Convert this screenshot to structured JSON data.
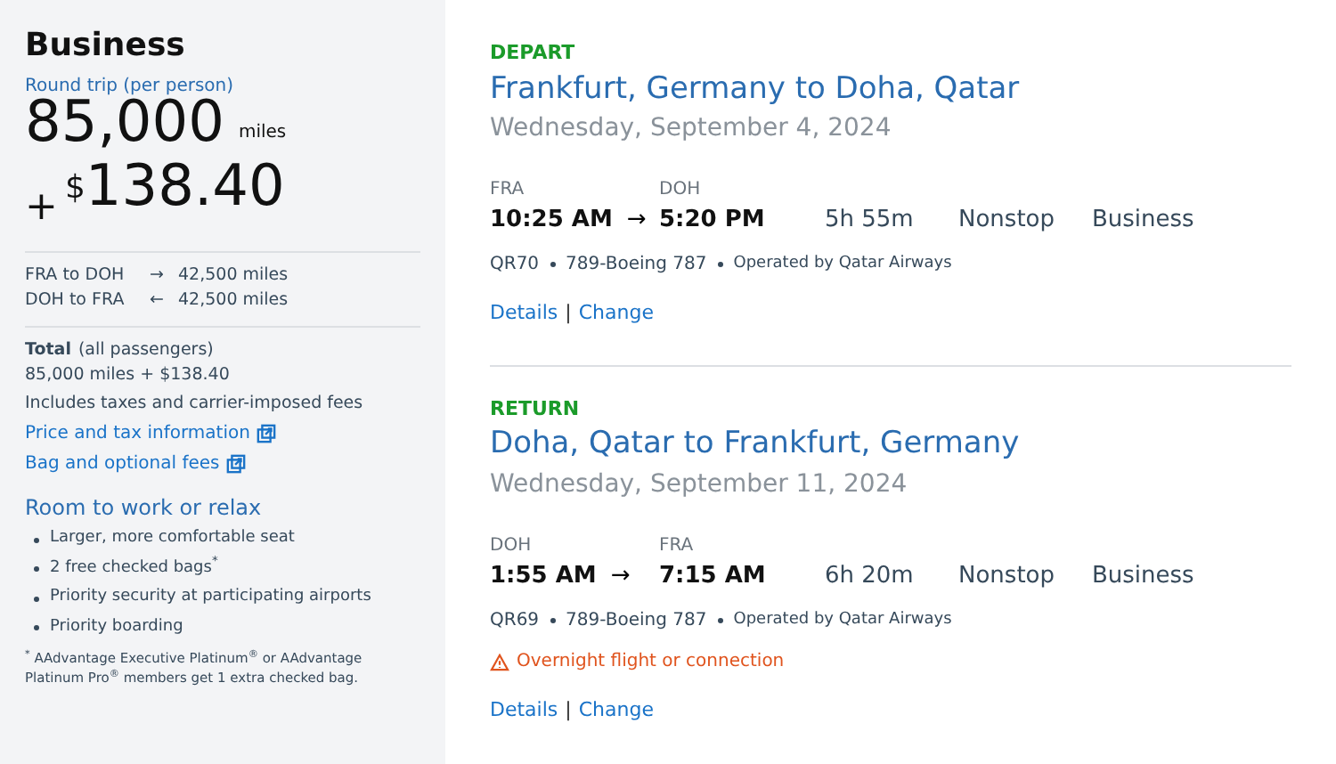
{
  "summary": {
    "cabin": "Business",
    "trip_type": "Round trip (per person)",
    "miles": "85,000",
    "miles_unit": "miles",
    "plus": "+",
    "currency": "$",
    "amount": "138.40",
    "segments": [
      {
        "route": "FRA to DOH",
        "arrow": "→",
        "miles": "42,500 miles"
      },
      {
        "route": "DOH to FRA",
        "arrow": "←",
        "miles": "42,500 miles"
      }
    ],
    "total_label": "Total",
    "total_note": "(all passengers)",
    "total_value": "85,000 miles + $138.40",
    "includes": "Includes taxes and carrier-imposed fees",
    "links": [
      "Price and tax information",
      "Bag and optional fees"
    ],
    "perks_title": "Room to work or relax",
    "perks": [
      "Larger, more comfortable seat",
      "2 free checked bags$^{*}$",
      "Priority security at participating airports",
      "Priority boarding"
    ],
    "footnote": "$^{*}$ AAdvantage Executive Platinum$^{®}$ or AAdvantage Platinum Pro$^{®}$ members get 1 extra checked bag."
  },
  "legs": [
    {
      "label": "DEPART",
      "title": "Frankfurt, Germany to Doha, Qatar",
      "date": "Wednesday, September 4, 2024",
      "from": "FRA",
      "to": "DOH",
      "depart_time": "10:25 AM",
      "arrow": "→",
      "arrive_time": "5:20 PM",
      "duration": "5h 55m",
      "stops": "Nonstop",
      "cabin": "Business",
      "flight": "QR70",
      "aircraft": "789-Boeing 787",
      "operator": "Operated by Qatar Airways",
      "links": [
        "Details",
        "Change"
      ],
      "link_separator": "|"
    },
    {
      "label": "RETURN",
      "title": "Doha, Qatar to Frankfurt, Germany",
      "date": "Wednesday, September 11, 2024",
      "from": "DOH",
      "to": "FRA",
      "depart_time": "1:55 AM",
      "arrow": "→",
      "arrive_time": "7:15 AM",
      "duration": "6h 20m",
      "stops": "Nonstop",
      "cabin": "Business",
      "flight": "QR69",
      "aircraft": "789-Boeing 787",
      "operator": "Operated by Qatar Airways",
      "warning": "Overnight flight or connection",
      "links": [
        "Details",
        "Change"
      ],
      "link_separator": "|"
    }
  ]
}
